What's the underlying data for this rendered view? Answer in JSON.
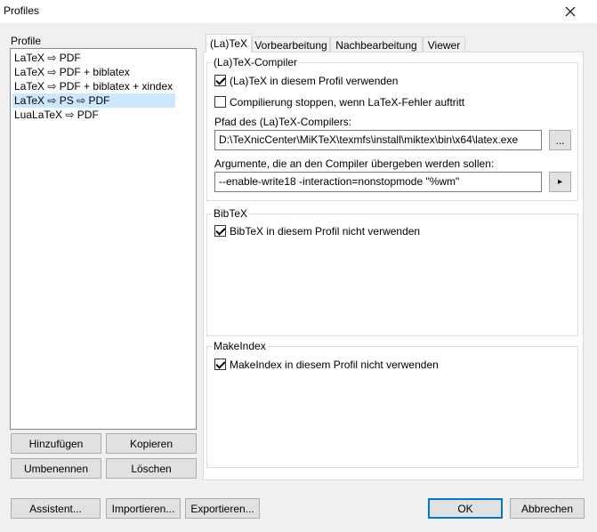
{
  "window": {
    "title": "Profiles"
  },
  "profiles": {
    "label": "Profile",
    "items": [
      {
        "label": "LaTeX ⇨ PDF"
      },
      {
        "label": "LaTeX ⇨ PDF + biblatex"
      },
      {
        "label": "LaTeX ⇨ PDF + biblatex + xindex"
      },
      {
        "label": "LaTeX ⇨ PS ⇨ PDF",
        "selected": true
      },
      {
        "label": "LuaLaTeX ⇨ PDF"
      }
    ],
    "buttons": {
      "add": "Hinzufügen",
      "copy": "Kopieren",
      "rename": "Umbenennen",
      "delete": "Löschen"
    }
  },
  "tabs": [
    {
      "label": "(La)TeX",
      "active": true
    },
    {
      "label": "Vorbearbeitung"
    },
    {
      "label": "Nachbearbeitung"
    },
    {
      "label": "Viewer"
    }
  ],
  "latex": {
    "group_title": "(La)TeX-Compiler",
    "use_in_profile": "(La)TeX in diesem Profil verwenden",
    "use_in_profile_checked": true,
    "stop_on_error": "Compilierung stoppen, wenn LaTeX-Fehler auftritt",
    "stop_on_error_checked": false,
    "path_label": "Pfad des (La)TeX-Compilers:",
    "path_value": "D:\\TeXnicCenter\\MiKTeX\\texmfs\\install\\miktex\\bin\\x64\\latex.exe",
    "browse_label": "...",
    "args_label": "Argumente, die an den Compiler übergeben werden sollen:",
    "args_value": "--enable-write18 -interaction=nonstopmode \"%wm\"",
    "args_menu_label": "▸"
  },
  "bibtex": {
    "group_title": "BibTeX",
    "not_use": "BibTeX in diesem Profil nicht verwenden",
    "not_use_checked": true
  },
  "makeindex": {
    "group_title": "MakeIndex",
    "not_use": "MakeIndex in diesem Profil nicht verwenden",
    "not_use_checked": true
  },
  "footer": {
    "wizard": "Assistent...",
    "import": "Importieren...",
    "export": "Exportieren...",
    "ok": "OK",
    "cancel": "Abbrechen"
  }
}
